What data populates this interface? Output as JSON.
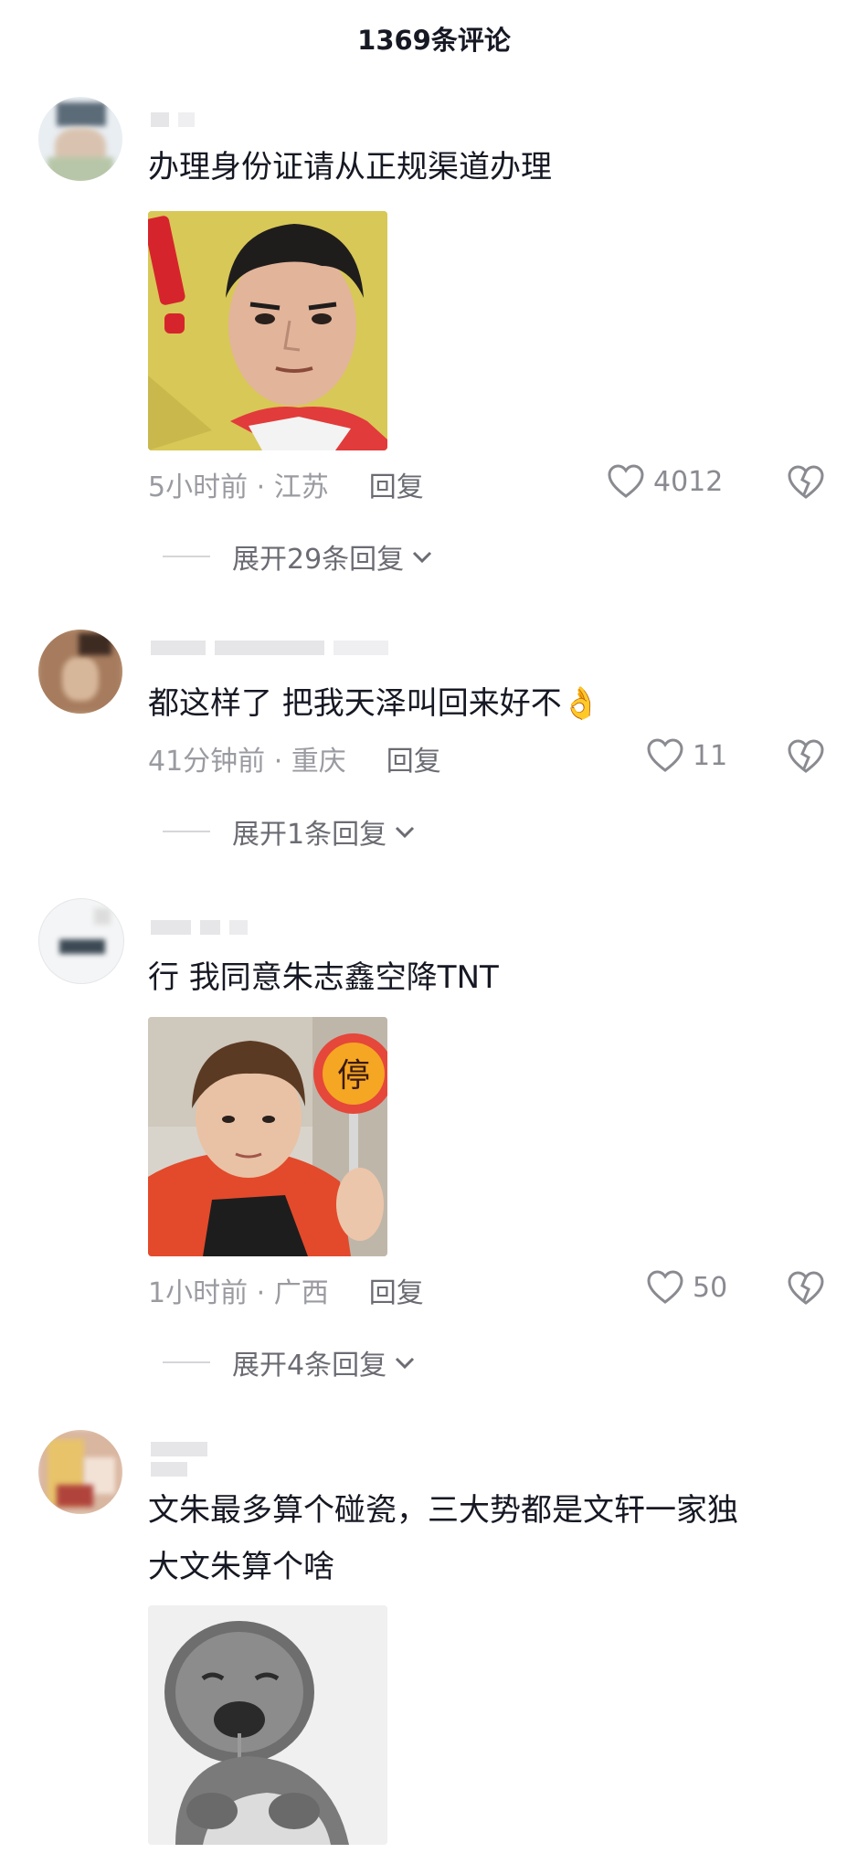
{
  "header": {
    "title": "1369条评论"
  },
  "comments": [
    {
      "text": "办理身份证请从正规渠道办理",
      "time_loc": "5小时前 · 江苏",
      "reply": "回复",
      "likes": "4012",
      "expand": "展开29条回复"
    },
    {
      "text": "都这样了 把我天泽叫回来好不👌",
      "time_loc": "41分钟前 · 重庆",
      "reply": "回复",
      "likes": "11",
      "expand": "展开1条回复"
    },
    {
      "text": "行 我同意朱志鑫空降TNT",
      "sticker_sign": "停",
      "time_loc": "1小时前 · 广西",
      "reply": "回复",
      "likes": "50",
      "expand": "展开4条回复"
    },
    {
      "text": "文朱最多算个碰瓷，三大势都是文轩一家独\n大文朱算个啥"
    }
  ],
  "icons": {
    "like": "heart-outline-icon",
    "dislike": "broken-heart-icon",
    "expand": "chevron-down-icon"
  },
  "colors": {
    "text": "#161823",
    "meta": "#9a9ba1",
    "action": "#6b6c73"
  }
}
